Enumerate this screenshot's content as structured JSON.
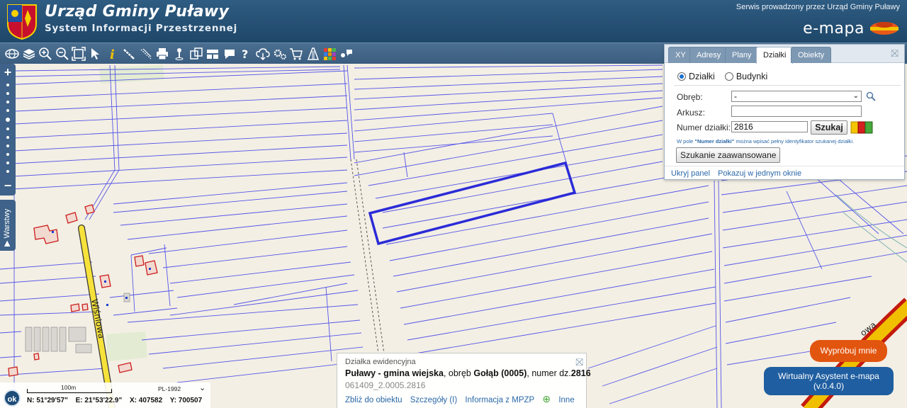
{
  "header": {
    "title": "Urząd Gminy Puławy",
    "subtitle": "System Informacji Przestrzennej",
    "service_text": "Serwis prowadzony przez Urząd Gminy Puławy",
    "brand": "e-mapa",
    "accent_color": "#2f5c82"
  },
  "toolbar": {
    "tools": [
      "globe-icon",
      "layers-icon",
      "zoom-in-icon",
      "zoom-out-icon",
      "zoom-extent-icon",
      "pointer-icon",
      "info-icon",
      "measure-distance-icon",
      "measure-area-icon",
      "print-icon",
      "pin-icon",
      "compare-icon",
      "split-icon",
      "chat-icon",
      "help-icon",
      "download-icon",
      "settings-icon",
      "cart-icon",
      "flag-icon",
      "palette-icon",
      "share-icon"
    ]
  },
  "sidebar": {
    "layers_label": "Warstwy"
  },
  "search_panel": {
    "tabs": [
      "XY",
      "Adresy",
      "Plany",
      "Działki",
      "Obiekty"
    ],
    "active_tab": "Działki",
    "radio_options": [
      "Działki",
      "Budynki"
    ],
    "selected_radio": "Działki",
    "obreb_label": "Obręb:",
    "obreb_value": "-",
    "arkusz_label": "Arkusz:",
    "arkusz_value": "",
    "numer_label": "Numer działki:",
    "numer_value": "2816",
    "search_button": "Szukaj",
    "hint_prefix": "W pole ",
    "hint_bold": "\"Numer działki\"",
    "hint_suffix": " można wpisać pełny identyfikator szukanej działki.",
    "advanced_button": "Szukanie zaawansowane",
    "hide_panel_link": "Ukryj panel",
    "single_window_link": "Pokazuj w jednym oknie"
  },
  "map": {
    "street_label": "Wiśniowa",
    "street_label_2": "owa",
    "highlight_color": "#2b2bd8"
  },
  "info_popup": {
    "type_label": "Działka ewidencyjna",
    "municipality": "Puławy - gmina wiejska",
    "obreb_text": ", obręb ",
    "obreb_name": "Gołąb (0005)",
    "numer_text": ", numer dz.",
    "numer": "2816",
    "identifier": "061409_2.0005.2816",
    "links": [
      "Zbliż do obiektu",
      "Szczegóły (I)",
      "Informacja z MPZP",
      "Inne"
    ]
  },
  "status": {
    "ok_label": "ok",
    "scale_label": "100m",
    "crs": "PL-1992",
    "lat": "N: 51°29'57\"",
    "lon": "E: 21°53'22.9\"",
    "x": "X: 407582",
    "y": "Y: 700507"
  },
  "assistant": {
    "try_label": "Wypróbuj mnie",
    "assistant_line1": "Wirtualny Asystent e-mapa",
    "assistant_line2": "(v.0.4.0)"
  }
}
